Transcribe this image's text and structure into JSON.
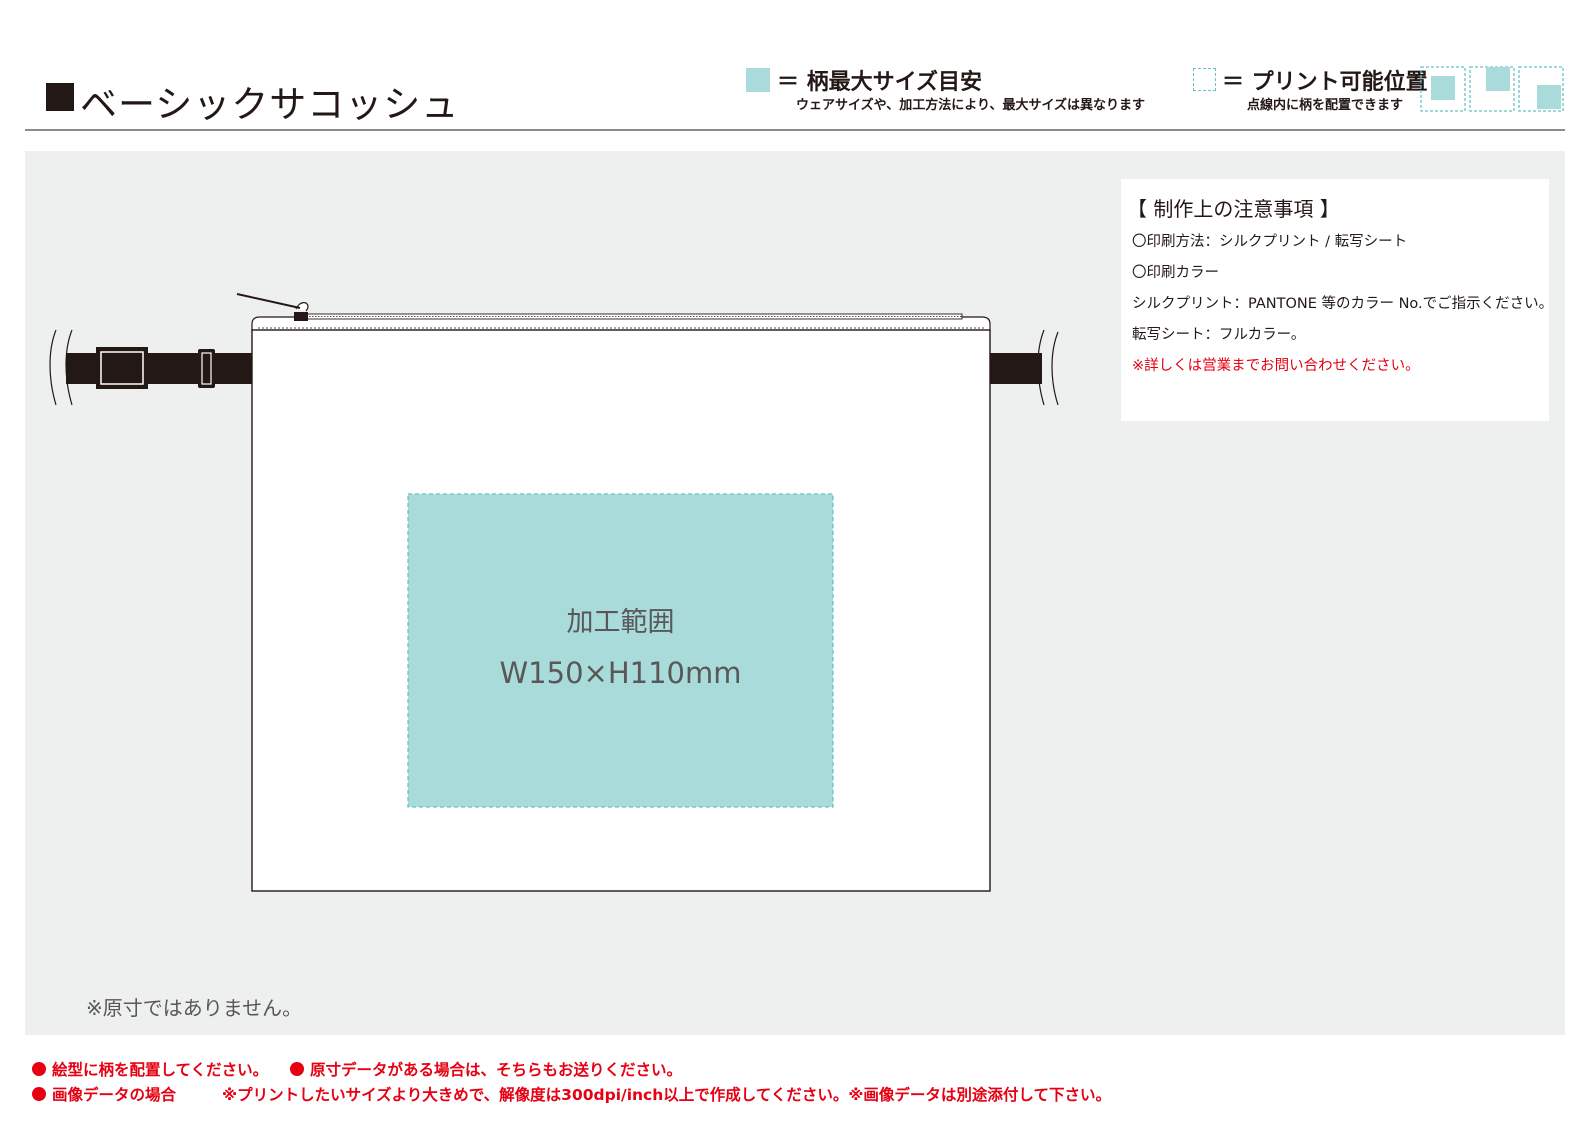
{
  "header": {
    "title": "ベーシックサコッシュ",
    "legend_max": {
      "title": "＝ 柄最大サイズ目安",
      "note": "ウェアサイズや、加工方法により、最大サイズは異なります"
    },
    "legend_printable": {
      "title": "＝ プリント可能位置",
      "note": "点線内に柄を配置できます"
    }
  },
  "notes": {
    "heading": "【 制作上の注意事項 】",
    "lines": [
      "〇印刷方法：シルクプリント / 転写シート",
      "〇印刷カラー",
      "シルクプリント：PANTONE 等のカラー No.でご指示ください。",
      "転写シート：フルカラー。",
      "※詳しくは営業までお問い合わせください。"
    ]
  },
  "print_area": {
    "label": "加工範囲",
    "size": "W150×H110mm"
  },
  "scale_note": "※原寸ではありません。",
  "footer": {
    "line1a": "絵型に柄を配置してください。",
    "line1b": "原寸データがある場合は、そちらもお送りください。",
    "line2a": "画像データの場合",
    "line2b": "※プリントしたいサイズより大きめで、解像度は300dpi/inch以上で作成してください。※画像データは別途添付して下さい。"
  },
  "colors": {
    "print_area_fill": "#a9dbdb",
    "print_area_border": "#66c2c4",
    "panel_background": "#eeefef",
    "warning_red": "#e60012",
    "strap": "#231815"
  }
}
